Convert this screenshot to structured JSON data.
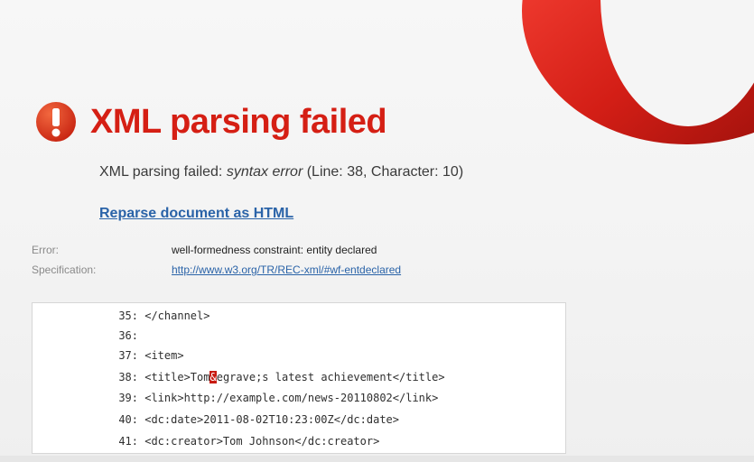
{
  "page": {
    "title": "XML parsing failed",
    "message_prefix": "XML parsing failed: ",
    "message_italic": "syntax error",
    "message_suffix": " (Line: 38, Character: 10)",
    "reparse_link": "Reparse document as HTML",
    "error_label": "Error:",
    "error_value": "well-formedness constraint: entity declared",
    "spec_label": "Specification:",
    "spec_link": "http://www.w3.org/TR/REC-xml/#wf-entdeclared"
  },
  "source": {
    "lines": [
      {
        "no": "35:",
        "code": "</channel>"
      },
      {
        "no": "36:",
        "code": ""
      },
      {
        "no": "37:",
        "code": "<item>"
      },
      {
        "no": "38:",
        "before": "<title>Tom",
        "highlight": "&",
        "after": "egrave;s latest achievement</title>"
      },
      {
        "no": "39:",
        "code": "<link>http://example.com/news-20110802</link>"
      },
      {
        "no": "40:",
        "code": "<dc:date>2011-08-02T10:23:00Z</dc:date>"
      },
      {
        "no": "41:",
        "code": "<dc:creator>Tom Johnson</dc:creator>"
      }
    ]
  },
  "icons": {
    "alert": "exclamation-circle-icon",
    "logo": "opera-logo"
  },
  "colors": {
    "title": "#d51f14",
    "link": "#2a63a8",
    "icon": "#d52b12",
    "highlight": "#c81b12",
    "logo": "#c81a12"
  }
}
